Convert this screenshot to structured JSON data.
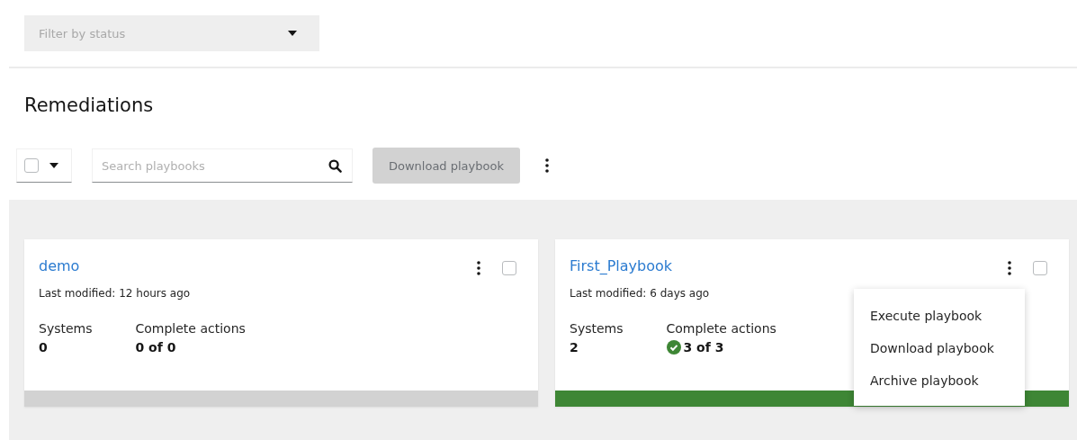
{
  "filter": {
    "placeholder": "Filter by status"
  },
  "title": "Remediations",
  "toolbar": {
    "select_all_checked": false,
    "search": {
      "placeholder": "Search playbooks"
    },
    "download_button": {
      "label": "Download playbook",
      "disabled": true
    }
  },
  "cards": [
    {
      "name": "demo",
      "modified": "Last modified: 12 hours ago",
      "systems_label": "Systems",
      "systems": "0",
      "actions_label": "Complete actions",
      "actions": "0 of 0",
      "complete": false,
      "checked": false,
      "level": 0
    },
    {
      "name": "First_Playbook",
      "modified": "Last modified: 6 days ago",
      "systems_label": "Systems",
      "systems": "2",
      "actions_label": "Complete actions",
      "actions": "3 of  3",
      "complete": true,
      "checked": false,
      "level": 1,
      "menu": [
        "Execute playbook",
        "Download playbook",
        "Archive playbook"
      ]
    }
  ]
}
